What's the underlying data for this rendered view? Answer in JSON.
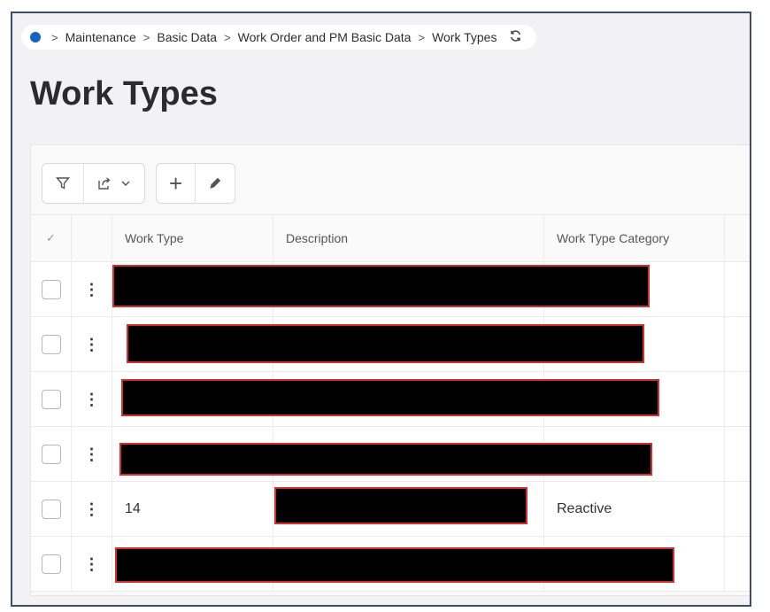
{
  "breadcrumb": {
    "items": [
      "Maintenance",
      "Basic Data",
      "Work Order and PM Basic Data",
      "Work Types"
    ],
    "separator": ">"
  },
  "page": {
    "title": "Work Types"
  },
  "toolbar": {
    "filter_icon": "filter-icon",
    "export_icon": "export-icon",
    "add_glyph": "+",
    "edit_icon": "pencil-icon"
  },
  "table": {
    "columns": [
      "Work Type",
      "Description",
      "Work Type Category"
    ],
    "rows": [
      {
        "redacted": true
      },
      {
        "redacted": true
      },
      {
        "redacted": true
      },
      {
        "redacted": true
      },
      {
        "redacted": false,
        "work_type": "14",
        "category": "Reactive"
      },
      {
        "redacted": true
      }
    ]
  },
  "colors": {
    "brand": "#1565c0",
    "frame_border": "#3d4f66",
    "redaction": "#000000",
    "redaction_outline": "#d32f2f"
  }
}
